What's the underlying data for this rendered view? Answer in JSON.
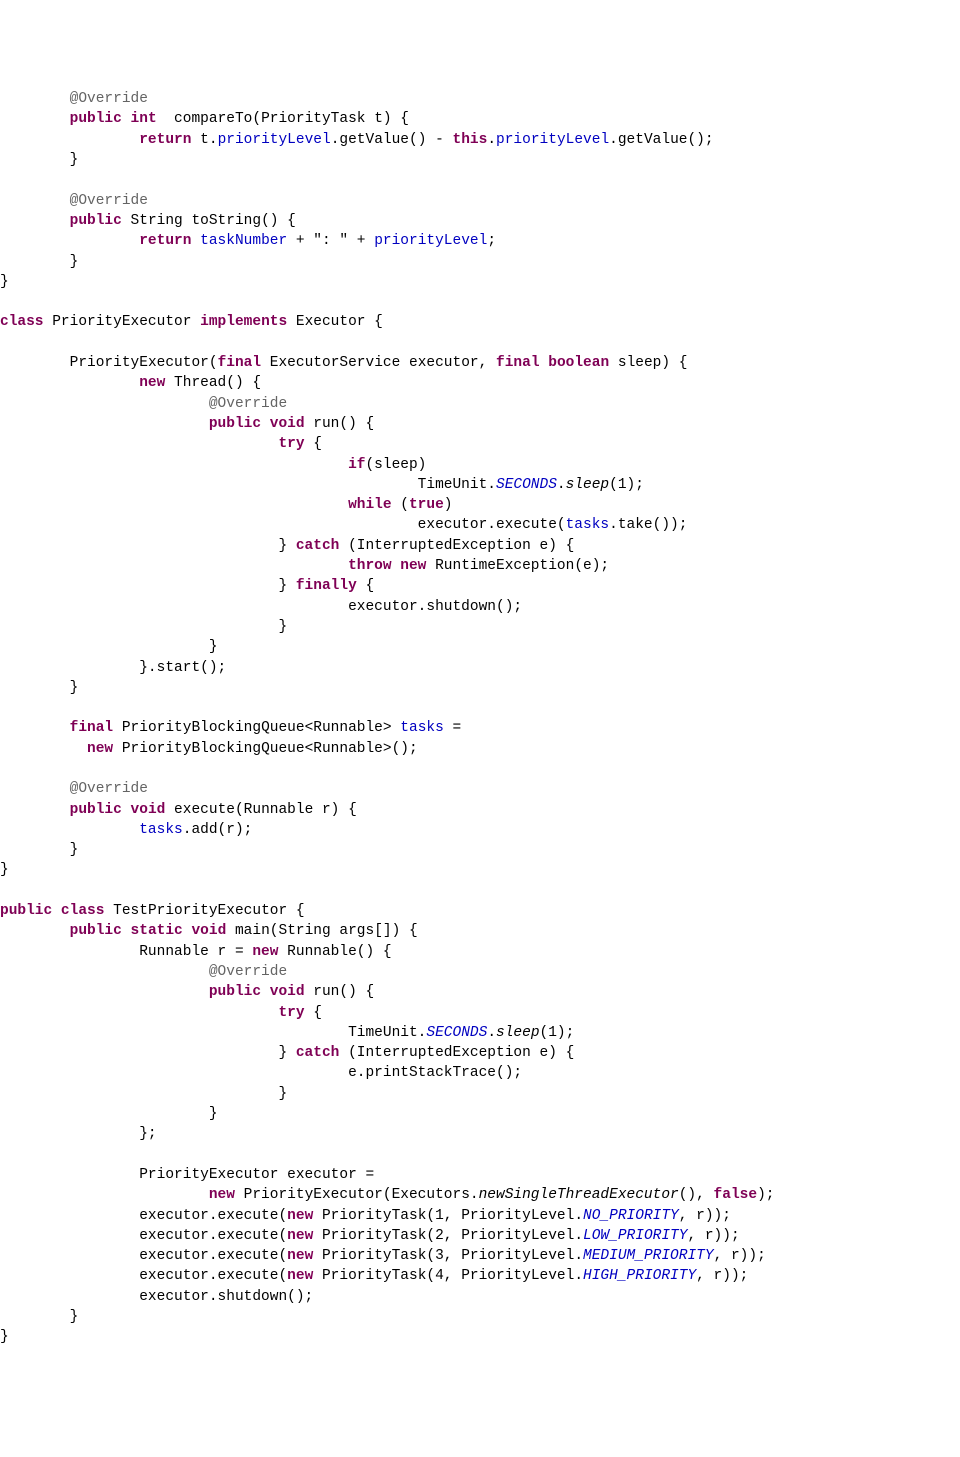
{
  "tokens": [
    {
      "indent": 1,
      "parts": [
        {
          "cls": "ann",
          "k": "t.ann1"
        }
      ]
    },
    {
      "indent": 1,
      "parts": [
        {
          "cls": "kw",
          "k": "t.kw_pub"
        },
        {
          "k": "t.sp"
        },
        {
          "cls": "kw",
          "k": "t.kw_int"
        },
        {
          "k": "t.sp"
        },
        {
          "k": "t.compareToSig"
        }
      ]
    },
    {
      "indent": 2,
      "parts": [
        {
          "cls": "kw",
          "k": "t.kw_return"
        },
        {
          "k": "t.ret1a"
        },
        {
          "cls": "field",
          "k": "t.fld_priorityLevel"
        },
        {
          "k": "t.ret1b"
        },
        {
          "cls": "kw",
          "k": "t.kw_this"
        },
        {
          "k": "t.dot"
        },
        {
          "cls": "field",
          "k": "t.fld_priorityLevel"
        },
        {
          "k": "t.ret1c"
        }
      ]
    },
    {
      "indent": 1,
      "parts": [
        {
          "k": "t.rbrace"
        }
      ]
    },
    {
      "indent": 0,
      "parts": [
        {
          "k": "t.empty"
        }
      ]
    },
    {
      "indent": 1,
      "parts": [
        {
          "cls": "ann",
          "k": "t.ann1"
        }
      ]
    },
    {
      "indent": 1,
      "parts": [
        {
          "cls": "kw",
          "k": "t.kw_pub"
        },
        {
          "k": "t.sp"
        },
        {
          "k": "t.toStringSig"
        }
      ]
    },
    {
      "indent": 2,
      "parts": [
        {
          "cls": "kw",
          "k": "t.kw_return"
        },
        {
          "k": "t.sp"
        },
        {
          "cls": "field",
          "k": "t.fld_taskNumber"
        },
        {
          "k": "t.ret2a"
        },
        {
          "cls": "field",
          "k": "t.fld_priorityLevel"
        },
        {
          "k": "t.semi"
        }
      ]
    },
    {
      "indent": 1,
      "parts": [
        {
          "k": "t.rbrace"
        }
      ]
    },
    {
      "indent": 0,
      "parts": [
        {
          "k": "t.rbrace"
        }
      ]
    },
    {
      "indent": 0,
      "parts": [
        {
          "k": "t.empty"
        }
      ]
    },
    {
      "indent": 0,
      "parts": [
        {
          "cls": "kw",
          "k": "t.kw_class"
        },
        {
          "k": "t.classPE1"
        },
        {
          "cls": "kw",
          "k": "t.kw_implements"
        },
        {
          "k": "t.classPE2"
        }
      ]
    },
    {
      "indent": 0,
      "parts": [
        {
          "k": "t.empty"
        }
      ]
    },
    {
      "indent": 1,
      "parts": [
        {
          "k": "t.ctorPE1"
        },
        {
          "cls": "kw",
          "k": "t.kw_final"
        },
        {
          "k": "t.ctorPE2"
        },
        {
          "cls": "kw",
          "k": "t.kw_final"
        },
        {
          "k": "t.sp"
        },
        {
          "cls": "kw",
          "k": "t.kw_boolean"
        },
        {
          "k": "t.ctorPE3"
        }
      ]
    },
    {
      "indent": 2,
      "parts": [
        {
          "cls": "kw",
          "k": "t.kw_new"
        },
        {
          "k": "t.newThread"
        }
      ]
    },
    {
      "indent": 3,
      "parts": [
        {
          "cls": "ann",
          "k": "t.ann1"
        }
      ]
    },
    {
      "indent": 3,
      "parts": [
        {
          "cls": "kw",
          "k": "t.kw_pub"
        },
        {
          "k": "t.sp"
        },
        {
          "cls": "kw",
          "k": "t.kw_void"
        },
        {
          "k": "t.runSig"
        }
      ]
    },
    {
      "indent": 4,
      "parts": [
        {
          "cls": "kw",
          "k": "t.kw_try"
        },
        {
          "k": "t.lbraceSp"
        }
      ]
    },
    {
      "indent": 5,
      "parts": [
        {
          "cls": "kw",
          "k": "t.kw_if"
        },
        {
          "k": "t.ifSleep"
        }
      ]
    },
    {
      "indent": 6,
      "parts": [
        {
          "k": "t.TimeUnitDot"
        },
        {
          "cls": "staticf",
          "k": "t.SECONDS"
        },
        {
          "k": "t.dot"
        },
        {
          "cls": "staticm",
          "k": "t.sleep"
        },
        {
          "k": "t.sleep1"
        }
      ]
    },
    {
      "indent": 5,
      "parts": [
        {
          "cls": "kw",
          "k": "t.kw_while"
        },
        {
          "k": "t.whileTrue1"
        },
        {
          "cls": "kw",
          "k": "t.kw_true"
        },
        {
          "k": "t.rparen"
        }
      ]
    },
    {
      "indent": 6,
      "parts": [
        {
          "k": "t.execTake1"
        },
        {
          "cls": "field",
          "k": "t.fld_tasks"
        },
        {
          "k": "t.execTake2"
        }
      ]
    },
    {
      "indent": 4,
      "parts": [
        {
          "k": "t.rbraceSp"
        },
        {
          "cls": "kw",
          "k": "t.kw_catch"
        },
        {
          "k": "t.catchIE"
        }
      ]
    },
    {
      "indent": 5,
      "parts": [
        {
          "cls": "kw",
          "k": "t.kw_throw"
        },
        {
          "k": "t.sp"
        },
        {
          "cls": "kw",
          "k": "t.kw_new"
        },
        {
          "k": "t.newRE"
        }
      ]
    },
    {
      "indent": 4,
      "parts": [
        {
          "k": "t.rbraceSp"
        },
        {
          "cls": "kw",
          "k": "t.kw_finally"
        },
        {
          "k": "t.lbraceSp"
        }
      ]
    },
    {
      "indent": 5,
      "parts": [
        {
          "k": "t.execShutdown"
        }
      ]
    },
    {
      "indent": 4,
      "parts": [
        {
          "k": "t.rbrace"
        }
      ]
    },
    {
      "indent": 3,
      "parts": [
        {
          "k": "t.rbrace"
        }
      ]
    },
    {
      "indent": 2,
      "parts": [
        {
          "k": "t.startCall"
        }
      ]
    },
    {
      "indent": 1,
      "parts": [
        {
          "k": "t.rbrace"
        }
      ]
    },
    {
      "indent": 0,
      "parts": [
        {
          "k": "t.empty"
        }
      ]
    },
    {
      "indent": 1,
      "parts": [
        {
          "cls": "kw",
          "k": "t.kw_final"
        },
        {
          "k": "t.pbq1"
        },
        {
          "cls": "field",
          "k": "t.fld_tasks"
        },
        {
          "k": "t.equals"
        }
      ]
    },
    {
      "indent": 1,
      "parts": [
        {
          "k": "t.pbqIndent"
        },
        {
          "cls": "kw",
          "k": "t.kw_new"
        },
        {
          "k": "t.pbq2"
        }
      ]
    },
    {
      "indent": 0,
      "parts": [
        {
          "k": "t.empty"
        }
      ]
    },
    {
      "indent": 1,
      "parts": [
        {
          "cls": "ann",
          "k": "t.ann1"
        }
      ]
    },
    {
      "indent": 1,
      "parts": [
        {
          "cls": "kw",
          "k": "t.kw_pub"
        },
        {
          "k": "t.sp"
        },
        {
          "cls": "kw",
          "k": "t.kw_void"
        },
        {
          "k": "t.executeSig"
        }
      ]
    },
    {
      "indent": 2,
      "parts": [
        {
          "cls": "field",
          "k": "t.fld_tasks"
        },
        {
          "k": "t.addR"
        }
      ]
    },
    {
      "indent": 1,
      "parts": [
        {
          "k": "t.rbrace"
        }
      ]
    },
    {
      "indent": 0,
      "parts": [
        {
          "k": "t.rbrace"
        }
      ]
    },
    {
      "indent": 0,
      "parts": [
        {
          "k": "t.empty"
        }
      ]
    },
    {
      "indent": 0,
      "parts": [
        {
          "cls": "kw",
          "k": "t.kw_pub"
        },
        {
          "k": "t.sp"
        },
        {
          "cls": "kw",
          "k": "t.kw_class"
        },
        {
          "k": "t.testClass"
        }
      ]
    },
    {
      "indent": 1,
      "parts": [
        {
          "cls": "kw",
          "k": "t.kw_pub"
        },
        {
          "k": "t.sp"
        },
        {
          "cls": "kw",
          "k": "t.kw_static"
        },
        {
          "k": "t.sp"
        },
        {
          "cls": "kw",
          "k": "t.kw_void"
        },
        {
          "k": "t.mainSig"
        }
      ]
    },
    {
      "indent": 2,
      "parts": [
        {
          "k": "t.runnableDecl1"
        },
        {
          "cls": "kw",
          "k": "t.kw_new"
        },
        {
          "k": "t.runnableDecl2"
        }
      ]
    },
    {
      "indent": 3,
      "parts": [
        {
          "cls": "ann",
          "k": "t.ann1"
        }
      ]
    },
    {
      "indent": 3,
      "parts": [
        {
          "cls": "kw",
          "k": "t.kw_pub"
        },
        {
          "k": "t.sp"
        },
        {
          "cls": "kw",
          "k": "t.kw_void"
        },
        {
          "k": "t.runSig"
        }
      ]
    },
    {
      "indent": 4,
      "parts": [
        {
          "cls": "kw",
          "k": "t.kw_try"
        },
        {
          "k": "t.lbraceSp"
        }
      ]
    },
    {
      "indent": 5,
      "parts": [
        {
          "k": "t.TimeUnitDot"
        },
        {
          "cls": "staticf",
          "k": "t.SECONDS"
        },
        {
          "k": "t.dot"
        },
        {
          "cls": "staticm",
          "k": "t.sleep"
        },
        {
          "k": "t.sleep1"
        }
      ]
    },
    {
      "indent": 4,
      "parts": [
        {
          "k": "t.rbraceSp"
        },
        {
          "cls": "kw",
          "k": "t.kw_catch"
        },
        {
          "k": "t.catchIE"
        }
      ]
    },
    {
      "indent": 5,
      "parts": [
        {
          "k": "t.printStack"
        }
      ]
    },
    {
      "indent": 4,
      "parts": [
        {
          "k": "t.rbrace"
        }
      ]
    },
    {
      "indent": 3,
      "parts": [
        {
          "k": "t.rbrace"
        }
      ]
    },
    {
      "indent": 2,
      "parts": [
        {
          "k": "t.anonEnd"
        }
      ]
    },
    {
      "indent": 0,
      "parts": [
        {
          "k": "t.empty"
        }
      ]
    },
    {
      "indent": 2,
      "parts": [
        {
          "k": "t.peDecl"
        }
      ]
    },
    {
      "indent": 3,
      "parts": [
        {
          "cls": "kw",
          "k": "t.kw_new"
        },
        {
          "k": "t.peNew1"
        },
        {
          "cls": "staticm",
          "k": "t.newSTE"
        },
        {
          "k": "t.peNew2"
        },
        {
          "cls": "kw",
          "k": "t.kw_false"
        },
        {
          "k": "t.rparenSemi"
        }
      ]
    },
    {
      "indent": 2,
      "parts": [
        {
          "k": "t.execExec"
        },
        {
          "cls": "kw",
          "k": "t.kw_new"
        },
        {
          "k": "t.pt1"
        },
        {
          "cls": "staticf",
          "k": "t.NO_PRI"
        },
        {
          "k": "t.ptEnd"
        }
      ]
    },
    {
      "indent": 2,
      "parts": [
        {
          "k": "t.execExec"
        },
        {
          "cls": "kw",
          "k": "t.kw_new"
        },
        {
          "k": "t.pt2"
        },
        {
          "cls": "staticf",
          "k": "t.LOW_PRI"
        },
        {
          "k": "t.ptEnd"
        }
      ]
    },
    {
      "indent": 2,
      "parts": [
        {
          "k": "t.execExec"
        },
        {
          "cls": "kw",
          "k": "t.kw_new"
        },
        {
          "k": "t.pt3"
        },
        {
          "cls": "staticf",
          "k": "t.MED_PRI"
        },
        {
          "k": "t.ptEnd"
        }
      ]
    },
    {
      "indent": 2,
      "parts": [
        {
          "k": "t.execExec"
        },
        {
          "cls": "kw",
          "k": "t.kw_new"
        },
        {
          "k": "t.pt4"
        },
        {
          "cls": "staticf",
          "k": "t.HIGH_PRI"
        },
        {
          "k": "t.ptEnd"
        }
      ]
    },
    {
      "indent": 2,
      "parts": [
        {
          "k": "t.execShutdown"
        }
      ]
    },
    {
      "indent": 1,
      "parts": [
        {
          "k": "t.rbrace"
        }
      ]
    },
    {
      "indent": 0,
      "parts": [
        {
          "k": "t.rbrace"
        }
      ]
    }
  ],
  "t": {
    "ann1": "@Override",
    "kw_pub": "public",
    "kw_int": "int",
    "kw_void": "void",
    "kw_return": "return",
    "kw_this": "this",
    "kw_class": "class",
    "kw_implements": "implements",
    "kw_final": "final",
    "kw_boolean": "boolean",
    "kw_new": "new",
    "kw_try": "try",
    "kw_if": "if",
    "kw_while": "while",
    "kw_true": "true",
    "kw_catch": "catch",
    "kw_throw": "throw",
    "kw_finally": "finally",
    "kw_static": "static",
    "kw_false": "false",
    "sp": " ",
    "dot": ".",
    "semi": ";",
    "rbrace": "}",
    "rbraceSp": "} ",
    "lbraceSp": " {",
    "rparen": ")",
    "rparenSemi": ");",
    "equals": " =",
    "empty": "",
    "compareToSig": " compareTo(PriorityTask t) {",
    "ret1a": " t.",
    "ret1b": ".getValue() - ",
    "ret1c": ".getValue();",
    "fld_priorityLevel": "priorityLevel",
    "fld_taskNumber": "taskNumber",
    "fld_tasks": "tasks",
    "toStringSig": "String toString() {",
    "ret2a": " + \": \" + ",
    "classPE1": " PriorityExecutor ",
    "classPE2": " Executor {",
    "ctorPE1": "PriorityExecutor(",
    "ctorPE2": " ExecutorService executor, ",
    "ctorPE3": " sleep) {",
    "newThread": " Thread() {",
    "runSig": " run() {",
    "ifSleep": "(sleep)",
    "TimeUnitDot": "TimeUnit.",
    "SECONDS": "SECONDS",
    "sleep": "sleep",
    "sleep1": "(1);",
    "whileTrue1": " (",
    "execTake1": "executor.execute(",
    "execTake2": ".take());",
    "catchIE": " (InterruptedException e) {",
    "newRE": " RuntimeException(e);",
    "execShutdown": "executor.shutdown();",
    "startCall": "}.start();",
    "pbq1": " PriorityBlockingQueue<Runnable> ",
    "pbqIndent": "  ",
    "pbq2": " PriorityBlockingQueue<Runnable>();",
    "executeSig": " execute(Runnable r) {",
    "addR": ".add(r);",
    "testClass": " TestPriorityExecutor {",
    "mainSig": " main(String args[]) {",
    "runnableDecl1": "Runnable r = ",
    "runnableDecl2": " Runnable() {",
    "printStack": "e.printStackTrace();",
    "anonEnd": "};",
    "peDecl": "PriorityExecutor executor =",
    "peNew1": " PriorityExecutor(Executors.",
    "newSTE": "newSingleThreadExecutor",
    "peNew2": "(), ",
    "execExec": "executor.execute(",
    "pt1": " PriorityTask(1, PriorityLevel.",
    "pt2": " PriorityTask(2, PriorityLevel.",
    "pt3": " PriorityTask(3, PriorityLevel.",
    "pt4": " PriorityTask(4, PriorityLevel.",
    "NO_PRI": "NO_PRIORITY",
    "LOW_PRI": "LOW_PRIORITY",
    "MED_PRI": "MEDIUM_PRIORITY",
    "HIGH_PRI": "HIGH_PRIORITY",
    "ptEnd": ", r));"
  },
  "indentUnit": "        "
}
